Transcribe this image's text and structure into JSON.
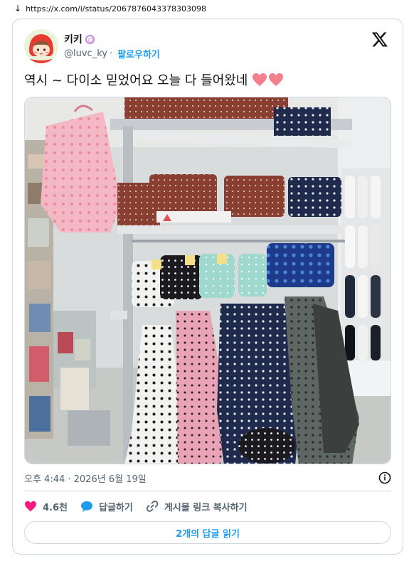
{
  "browser": {
    "url": "https://x.com/i/status/2067876043378303098"
  },
  "tweet": {
    "author_name": "키키",
    "author_handle": "@luvc_ky",
    "separator": "·",
    "follow_label": "팔로우하기",
    "text": "역시 ~ 다이소 믿었어요 오늘 다 들어왔네",
    "timestamp": "오후 4:44 · 2026년 6월 19일",
    "likes": "4.6천",
    "reply_label": "답글하기",
    "copy_link_label": "게시물 링크 복사하기",
    "read_replies_label": "2개의 답글 읽기"
  },
  "icons": {
    "download": "arrow-down-icon",
    "badge": "spiral-icon",
    "logo": "x-logo-icon",
    "info": "info-icon",
    "like": "heart-icon",
    "reply": "speech-bubble-icon",
    "link": "link-icon"
  },
  "colors": {
    "accent": "#1d9bf0",
    "like": "#f91880",
    "text_secondary": "#536471",
    "border": "#cfd9de"
  }
}
